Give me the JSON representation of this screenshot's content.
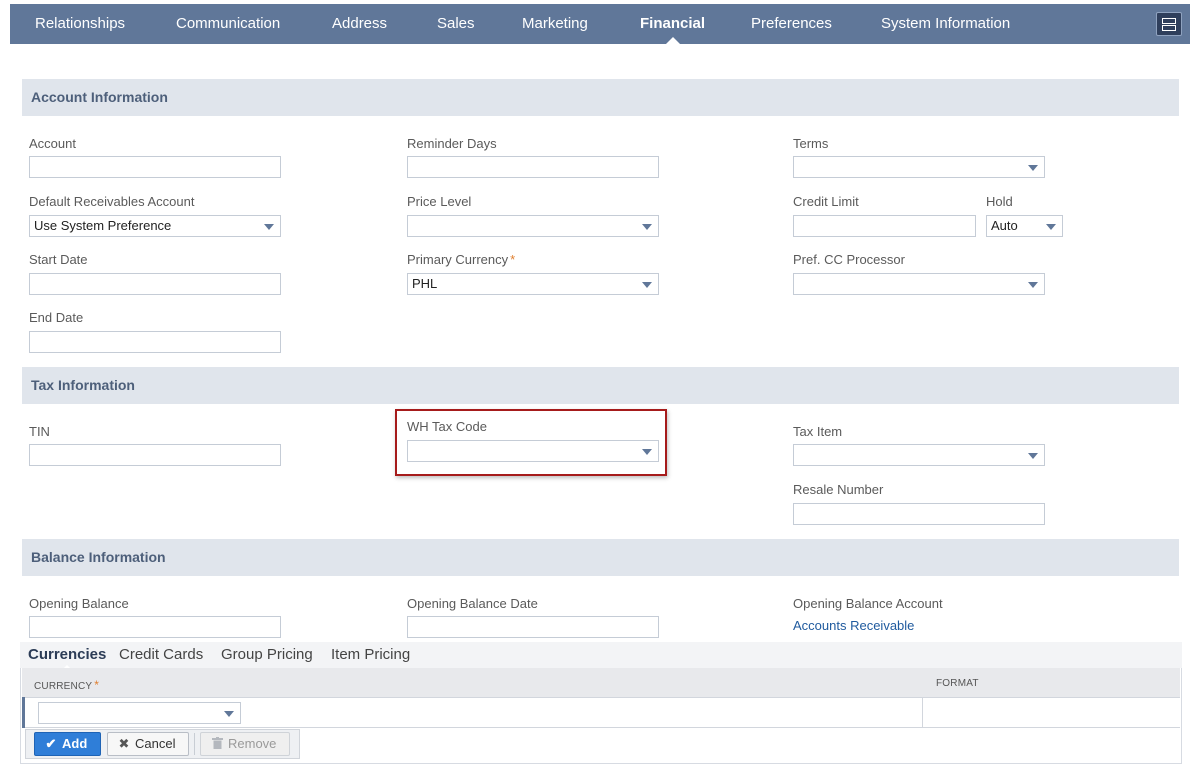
{
  "nav": {
    "tabs": [
      "Relationships",
      "Communication",
      "Address",
      "Sales",
      "Marketing",
      "Financial",
      "Preferences",
      "System Information"
    ],
    "active": "Financial"
  },
  "sections": {
    "account": "Account Information",
    "tax": "Tax Information",
    "balance": "Balance Information"
  },
  "fields": {
    "account": {
      "label": "Account",
      "value": ""
    },
    "reminder_days": {
      "label": "Reminder Days",
      "value": ""
    },
    "terms": {
      "label": "Terms",
      "value": ""
    },
    "default_receivables": {
      "label": "Default Receivables Account",
      "value": "Use System Preference"
    },
    "price_level": {
      "label": "Price Level",
      "value": ""
    },
    "credit_limit": {
      "label": "Credit Limit",
      "value": ""
    },
    "hold": {
      "label": "Hold",
      "value": "Auto"
    },
    "start_date": {
      "label": "Start Date",
      "value": ""
    },
    "primary_currency": {
      "label": "Primary Currency",
      "value": "PHL",
      "required_mark": "*"
    },
    "pref_cc_processor": {
      "label": "Pref. CC Processor",
      "value": ""
    },
    "end_date": {
      "label": "End Date",
      "value": ""
    },
    "tin": {
      "label": "TIN",
      "value": ""
    },
    "wh_tax_code": {
      "label": "WH Tax Code",
      "value": ""
    },
    "tax_item": {
      "label": "Tax Item",
      "value": ""
    },
    "resale_number": {
      "label": "Resale Number",
      "value": ""
    },
    "opening_balance": {
      "label": "Opening Balance",
      "value": ""
    },
    "opening_balance_date": {
      "label": "Opening Balance Date",
      "value": ""
    },
    "opening_balance_account": {
      "label": "Opening Balance Account",
      "value": "Accounts Receivable"
    }
  },
  "subtabs": {
    "items": [
      "Currencies",
      "Credit Cards",
      "Group Pricing",
      "Item Pricing"
    ],
    "active": "Currencies"
  },
  "grid": {
    "columns": {
      "currency": "CURRENCY",
      "format": "FORMAT"
    },
    "required_mark": "*",
    "row": {
      "currency": "",
      "format": ""
    }
  },
  "buttons": {
    "add": "Add",
    "cancel": "Cancel",
    "remove": "Remove"
  },
  "icons": {
    "add": "check-icon",
    "cancel": "x-icon",
    "remove": "trash-icon",
    "menu": "layout-icon"
  },
  "colors": {
    "nav_bg": "#607799",
    "section_bg": "#e0e5ec",
    "highlight": "#a61b1b",
    "primary_button": "#2f7ed8",
    "required": "#e07f2f",
    "link": "#1f5a9e"
  }
}
